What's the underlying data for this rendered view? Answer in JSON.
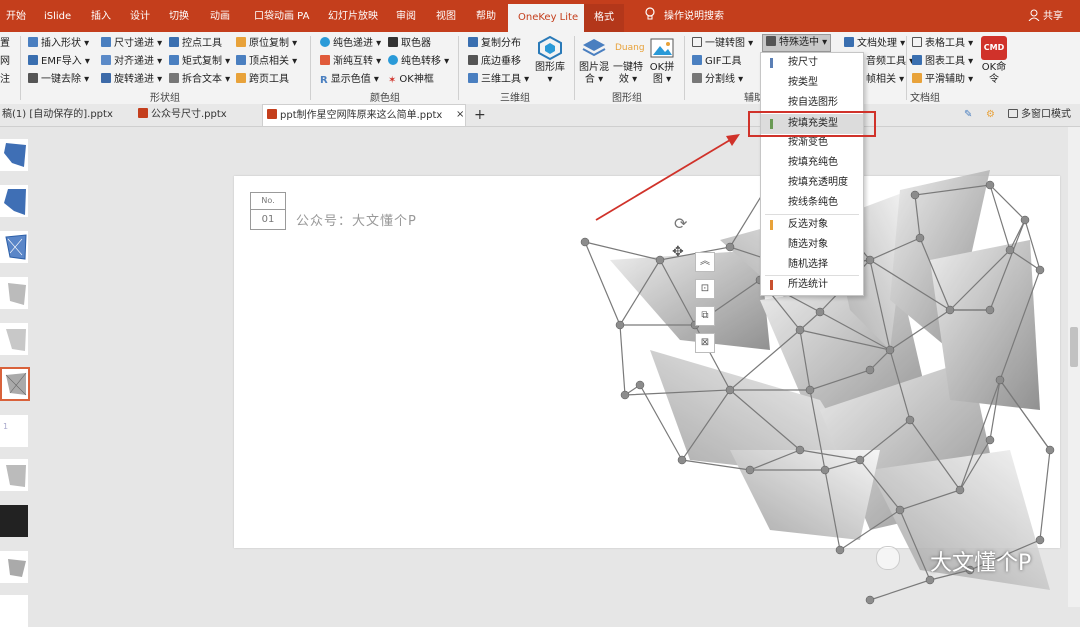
{
  "titlebar": {
    "tabs": [
      "开始",
      "iSlide",
      "插入",
      "设计",
      "切换",
      "动画",
      "口袋动画 PA",
      "幻灯片放映",
      "审阅",
      "视图",
      "帮助",
      "OneKey Lite",
      "格式"
    ],
    "search_label": "操作说明搜索",
    "share_label": "共享"
  },
  "ribbon": {
    "left_edge": [
      "置",
      "网",
      "注"
    ],
    "shape_group": {
      "col1": [
        "插入形状",
        "EMF导入",
        "一键去除"
      ],
      "col2": [
        "尺寸递进",
        "对齐递进",
        "旋转递进"
      ],
      "col3": [
        "控点工具",
        "矩式复制",
        "拆合文本"
      ],
      "col4": [
        "原位复制",
        "顶点相关",
        "跨页工具"
      ],
      "label": "形状组"
    },
    "color_group": {
      "col1": [
        "纯色递进",
        "渐纯互转",
        "显示色值"
      ],
      "col2": [
        "取色器",
        "纯色转移",
        "OK神框"
      ],
      "label": "颜色组"
    },
    "threed_group": {
      "col1": [
        "复制分布",
        "底边垂移",
        "三维工具"
      ],
      "big": "图形库",
      "label": "三维组"
    },
    "image_group": {
      "big1": "图片混合",
      "big2": "一键特效",
      "big2_icon_text": "Duang",
      "big3": "OK拼图",
      "label": "图形组"
    },
    "assist_group": {
      "col1": [
        "一键转图",
        "GIF工具",
        "分割线"
      ],
      "special": "特殊选中",
      "col3": [
        "文档处理",
        "音频工具",
        "帧相关"
      ],
      "label": "辅助"
    },
    "doc_group": {
      "col1": [
        "表格工具",
        "图表工具",
        "平滑辅助"
      ],
      "cmd_icon": "CMD",
      "cmd": "OK命令",
      "label": "文档组"
    }
  },
  "doctabs": {
    "tab1": "稿(1) [自动保存的].pptx",
    "tab2": "公众号尺寸.pptx",
    "tab3": "ppt制作星空网阵原来这么简单.pptx",
    "close": "×",
    "add": "+",
    "multiwindow": "多窗口模式"
  },
  "dropdown": {
    "items": [
      {
        "label": "按尺寸",
        "color": "#5b7fb5"
      },
      {
        "label": "按类型",
        "color": ""
      },
      {
        "label": "按自选图形",
        "color": ""
      },
      {
        "label": "按填充类型",
        "color": "#6a9a55"
      },
      {
        "label": "按渐变色",
        "color": ""
      },
      {
        "label": "按填充纯色",
        "color": ""
      },
      {
        "label": "按填充透明度",
        "color": ""
      },
      {
        "label": "按线条纯色",
        "color": ""
      },
      {
        "label": "反选对象",
        "color": "#e8a23a"
      },
      {
        "label": "随选对象",
        "color": ""
      },
      {
        "label": "随机选择",
        "color": ""
      },
      {
        "label": "所选统计",
        "color": "#c8502e"
      }
    ],
    "highlight_index": 3
  },
  "slide": {
    "no_label": "No.",
    "no_value": "01",
    "subtitle": "公众号：大文懂个P"
  },
  "watermark": "大文懂个P",
  "colors": {
    "ribbon_red": "#c43e1c",
    "highlight_box": "#d0322a",
    "arrow": "#d0322a"
  }
}
